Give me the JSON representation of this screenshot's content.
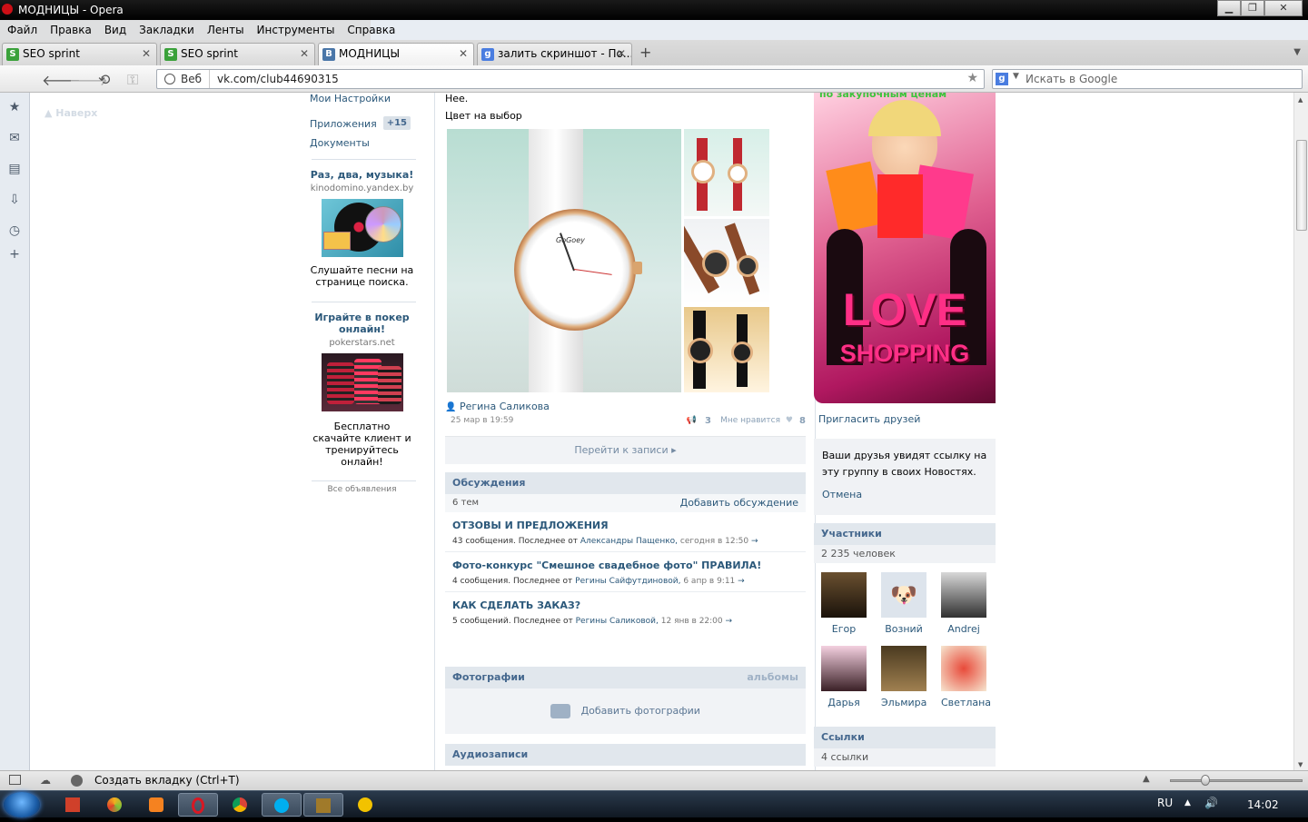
{
  "window": {
    "title": "МОДНИЦЫ - Opera"
  },
  "menu": [
    "Файл",
    "Правка",
    "Вид",
    "Закладки",
    "Ленты",
    "Инструменты",
    "Справка"
  ],
  "tabs": [
    {
      "label": "SEO sprint"
    },
    {
      "label": "SEO sprint"
    },
    {
      "label": "МОДНИЦЫ"
    },
    {
      "label": "залить скриншот - По..."
    }
  ],
  "toolbar": {
    "web_label": "Веб",
    "url": "vk.com/club44690315",
    "search_placeholder": "Искать в Google"
  },
  "page": {
    "naverh": "Наверх",
    "left_menu": {
      "settings": "Мои Настройки",
      "apps": "Приложения",
      "apps_badge": "+15",
      "docs": "Документы"
    },
    "ads": [
      {
        "title": "Раз, два, музыка!",
        "domain": "kinodomino.yandex.by",
        "text": "Слушайте песни на странице поиска."
      },
      {
        "title": "Играйте в покер онлайн!",
        "domain": "pokerstars.net",
        "text": "Бесплатно скачайте клиент и тренируйтесь онлайн!"
      }
    ],
    "all_ads": "Все объявления",
    "post": {
      "line1": "Нее.",
      "line2": "Цвет на выбор",
      "watch_brand": "GoGoey",
      "author": "Регина Саликова",
      "date": "25 мар в 19:59",
      "reposts": "3",
      "likes_label": "Мне нравится",
      "likes": "8",
      "goto": "Перейти к записи"
    },
    "discussions": {
      "title": "Обсуждения",
      "count": "6 тем",
      "add": "Добавить обсуждение",
      "topics": [
        {
          "title": "ОТЗОВЫ И ПРЕДЛОЖЕНИЯ",
          "count": "43 сообщения. Последнее от",
          "author": "Александры Пащенко,",
          "date": "сегодня в 12:50"
        },
        {
          "title": "Фото-конкурс \"Смешное свадебное фото\" ПРАВИЛА!",
          "count": "4 сообщения. Последнее от",
          "author": "Регины Сайфутдиновой,",
          "date": "6 апр в 9:11"
        },
        {
          "title": "КАК СДЕЛАТЬ ЗАКАЗ?",
          "count": "5 сообщений. Последнее от",
          "author": "Регины Саликовой,",
          "date": "12 янв в 22:00"
        }
      ]
    },
    "photos": {
      "title": "Фотографии",
      "albums": "альбомы",
      "add": "Добавить фотографии"
    },
    "audio": {
      "title": "Аудиозаписи"
    },
    "right": {
      "banner_top": "по закупочным ценам",
      "banner_love": "LOVE",
      "banner_shopping": "SHOPPING",
      "invite": "Пригласить друзей",
      "notice": "Ваши друзья увидят ссылку на эту группу в своих Новостях.",
      "cancel": "Отмена",
      "members_title": "Участники",
      "members_count": "2 235 человек",
      "members": [
        "Егор",
        "Возний",
        "Andrej",
        "Дарья",
        "Эльмира",
        "Светлана"
      ],
      "links_title": "Ссылки",
      "links_count": "4 ссылки"
    }
  },
  "statusbar": {
    "new_tab": "Создать вкладку (Ctrl+T)"
  },
  "taskbar": {
    "lang": "RU",
    "time": "14:02"
  }
}
